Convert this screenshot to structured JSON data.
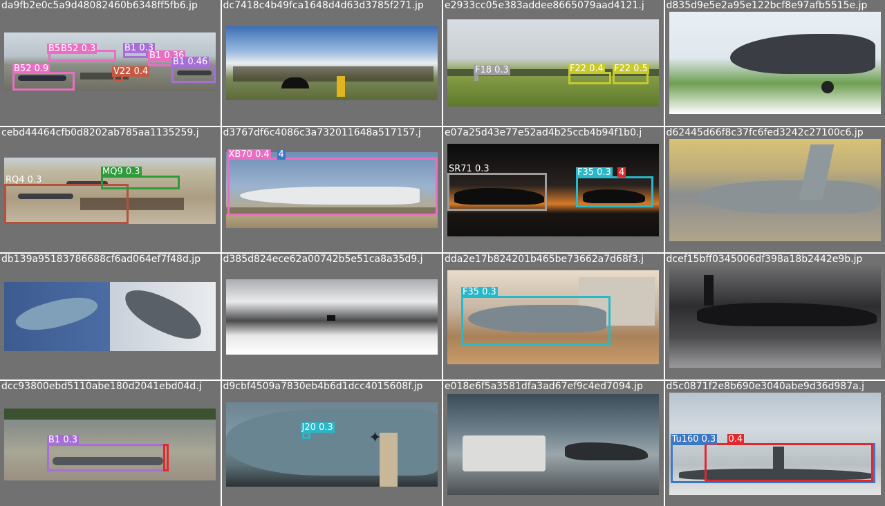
{
  "tiles": [
    {
      "title": "da9fb2e0c5a9d48082460b6348ff5fb6.jp",
      "labels": [
        "B52 0.3",
        "B52 0.3",
        "B1 0.3",
        "B1 0.36",
        "B1 0.46",
        "B52 0.9",
        "V22 0.4"
      ]
    },
    {
      "title": "dc7418c4b49fca1648d4d63d3785f271.jp",
      "labels": []
    },
    {
      "title": "e2933cc05e383addee8665079aad4121.j",
      "labels": [
        "F18 0.3",
        "F22 0.4",
        "F22 0.5"
      ]
    },
    {
      "title": "d835d9e5e2a95e122bcf8e97afb5515e.jp",
      "labels": []
    },
    {
      "title": "cebd44464cfb0d8202ab785aa1135259.j",
      "labels": [
        "RQ4 0.3",
        "MQ9 0.3"
      ]
    },
    {
      "title": "d3767df6c4086c3a732011648a517157.j",
      "labels": [
        "XB70 0.4",
        "4"
      ]
    },
    {
      "title": "e07a25d43e77e52ad4b25ccb4b94f1b0.j",
      "labels": [
        "SR71 0.3",
        "F35 0.3",
        "4"
      ]
    },
    {
      "title": "d62445d66f8c37fc6fed3242c27100c6.jp",
      "labels": []
    },
    {
      "title": "db139a95183786688cf6ad064ef7f48d.jp",
      "labels": []
    },
    {
      "title": "d385d824ece62a00742b5e51ca8a35d9.j",
      "labels": []
    },
    {
      "title": "dda2e17b824201b465be73662a7d68f3.j",
      "labels": [
        "F35 0.3"
      ]
    },
    {
      "title": "dcef15bff0345006df398a18b2442e9b.jp",
      "labels": []
    },
    {
      "title": "dcc93800ebd5110abe180d2041ebd04d.j",
      "labels": [
        "B1 0.3"
      ]
    },
    {
      "title": "d9cbf4509a7830eb4b6d1dcc4015608f.jp",
      "labels": [
        "J20 0.3"
      ]
    },
    {
      "title": "e018e6f5a3581dfa3ad67ef9c4ed7094.jp",
      "labels": []
    },
    {
      "title": "d5c0871f2e8b690e3040abe9d36d987a.j",
      "labels": [
        "Tu160 0.3",
        "0.4"
      ]
    }
  ],
  "colors": {
    "tile_bg": "#717171",
    "b52": "#e96fc3",
    "b1": "#a86ed8",
    "v22": "#c55a43",
    "f18": "#9e9e9e",
    "f22": "#c8c92a",
    "rq4": "#b4513c",
    "mq9": "#2e9a3a",
    "xb70": "#e96fc3",
    "sr71": "#9e9e9e",
    "f35": "#28b8c9",
    "red": "#e0282e",
    "j20": "#28b8c9",
    "tu160": "#3c78c4"
  }
}
